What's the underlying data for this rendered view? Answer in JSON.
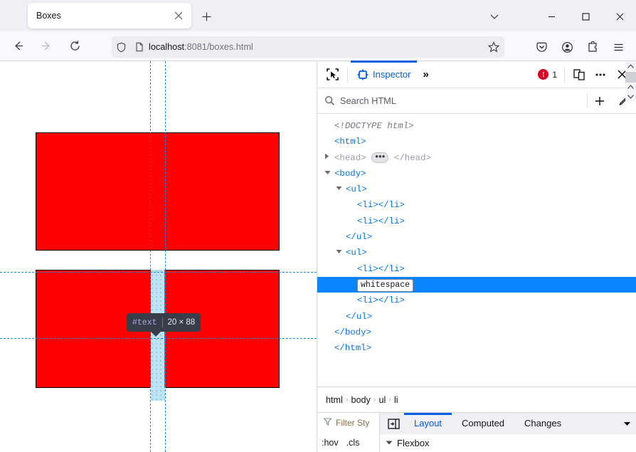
{
  "browser": {
    "tab": {
      "title": "Boxes",
      "close_icon": "close-icon"
    },
    "newtab_label": "+",
    "window_controls": {
      "list": "chevron-down-icon",
      "minimize": "minimize-icon",
      "maximize": "maximize-icon",
      "close": "close-icon"
    },
    "nav": {
      "back": "back-arrow-icon",
      "forward": "forward-arrow-icon",
      "reload": "reload-icon"
    },
    "url": {
      "host": "localhost",
      "rest": ":8081/boxes.html",
      "shield_icon": "shield-icon",
      "page_icon": "page-icon",
      "bookmark_icon": "star-icon"
    },
    "toolbar_right": [
      "pocket-icon",
      "account-icon",
      "extensions-icon",
      "hamburger-menu-icon"
    ]
  },
  "page": {
    "tooltip": {
      "node": "#text",
      "dimensions": "20 × 88"
    },
    "boxes_color": "#ff0000",
    "highlight_color": "#87ceeb",
    "guide_color": "#1b87d6"
  },
  "devtools": {
    "toolbar": {
      "picker_icon": "element-picker-icon",
      "active_tab": "Inspector",
      "overflow_label": "»",
      "error_count": "1",
      "responsive_icon": "responsive-design-mode-icon",
      "meatball_icon": "more-options-icon",
      "close_icon": "close-devtools-icon"
    },
    "search": {
      "placeholder": "Search HTML",
      "icon": "search-icon",
      "add_icon": "plus-icon",
      "eyedropper_icon": "eyedropper-icon"
    },
    "markup": [
      {
        "indent": 1,
        "twisty": "",
        "text": "<!DOCTYPE html>",
        "kind": "doctype"
      },
      {
        "indent": 1,
        "twisty": "",
        "text": "<html>",
        "kind": "tag"
      },
      {
        "indent": 1,
        "twisty": "collapsed",
        "text": "<head>",
        "close": "</head>",
        "kind": "collapsed-head"
      },
      {
        "indent": 1,
        "twisty": "expanded",
        "text": "<body>",
        "kind": "tag"
      },
      {
        "indent": 2,
        "twisty": "expanded",
        "text": "<ul>",
        "kind": "tag"
      },
      {
        "indent": 3,
        "twisty": "",
        "text": "<li></li>",
        "kind": "tag"
      },
      {
        "indent": 3,
        "twisty": "",
        "text": "<li></li>",
        "kind": "tag"
      },
      {
        "indent": 2,
        "twisty": "",
        "text": "</ul>",
        "kind": "tag"
      },
      {
        "indent": 2,
        "twisty": "expanded",
        "text": "<ul>",
        "kind": "tag"
      },
      {
        "indent": 3,
        "twisty": "",
        "text": "<li></li>",
        "kind": "tag"
      },
      {
        "indent": 3,
        "twisty": "",
        "text": "whitespace",
        "kind": "whitespace",
        "selected": true
      },
      {
        "indent": 3,
        "twisty": "",
        "text": "<li></li>",
        "kind": "tag"
      },
      {
        "indent": 2,
        "twisty": "",
        "text": "</ul>",
        "kind": "tag"
      },
      {
        "indent": 1,
        "twisty": "",
        "text": "</body>",
        "kind": "tag"
      },
      {
        "indent": 1,
        "twisty": "",
        "text": "</html>",
        "kind": "tag"
      }
    ],
    "breadcrumb": [
      "html",
      "body",
      "ul",
      "li"
    ],
    "breadcrumb_separator": "›",
    "rules_pane": {
      "filter_placeholder": "Filter Sty",
      "filter_icon": "filter-icon",
      "hov_label": ":hov",
      "cls_label": ".cls"
    },
    "panel_tabs": {
      "split_icon": "split-view-icon",
      "tabs": [
        "Layout",
        "Computed",
        "Changes"
      ],
      "active": "Layout",
      "dropdown_icon": "chevron-down-icon"
    },
    "accordion": {
      "label": "Flexbox",
      "twisty": "expanded"
    }
  }
}
